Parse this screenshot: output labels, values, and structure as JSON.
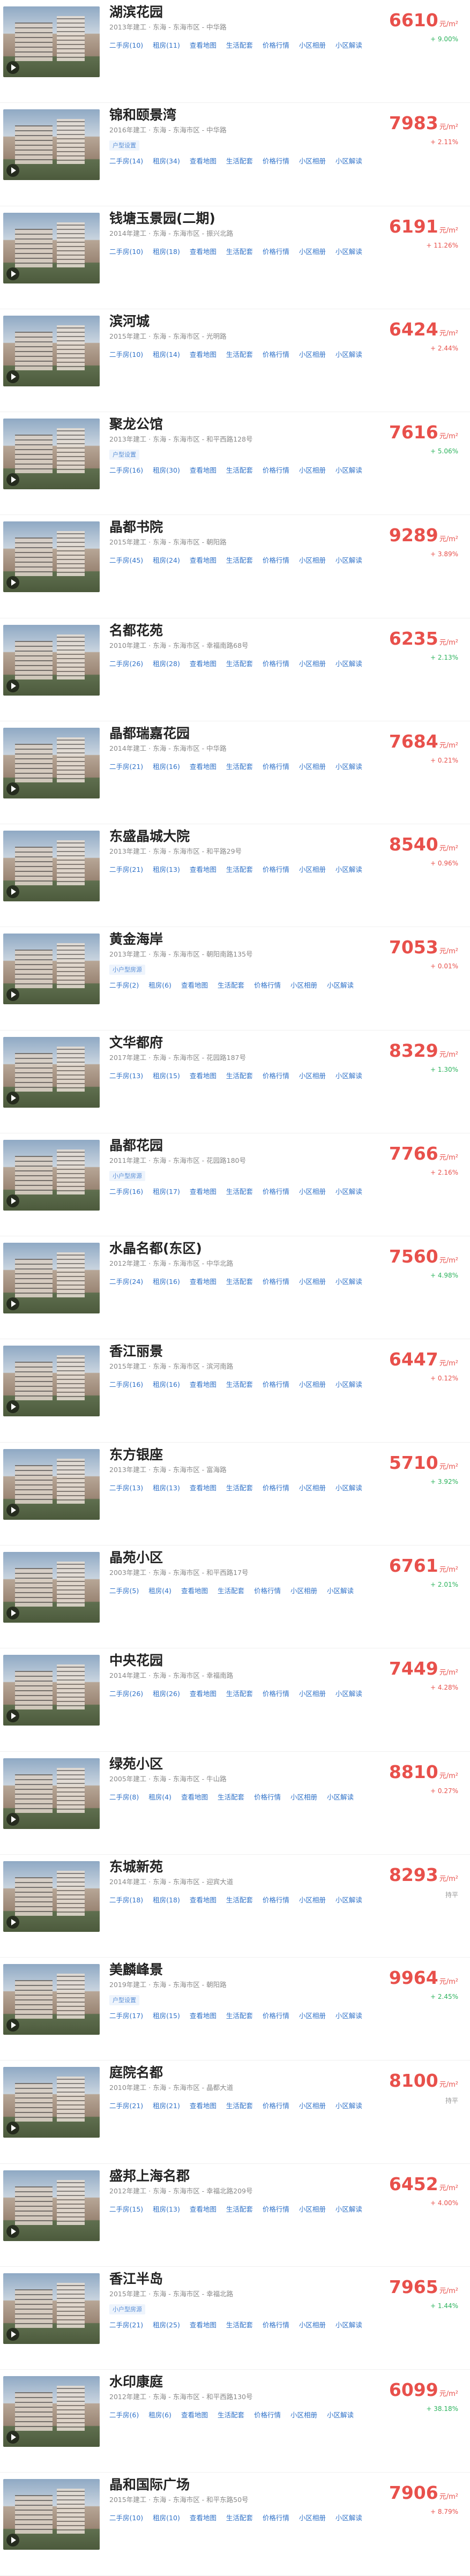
{
  "link_labels": [
    "二手房",
    "租房",
    "查看地图",
    "生活配套",
    "价格行情",
    "小区相册",
    "小区解读"
  ],
  "price_unit": "元/m²",
  "items": [
    {
      "name": "湖滨花园",
      "info": "2013年建工 · 东海 - 东海市区 - 中华路",
      "tag": "",
      "sale": "(10)",
      "rent": "(11)",
      "price": "6610",
      "change": "+ 9.00%",
      "dir": "up"
    },
    {
      "name": "锦和颐景湾",
      "info": "2016年建工 · 东海 - 东海市区 - 中华路",
      "tag": "户型设置",
      "sale": "(14)",
      "rent": "(34)",
      "price": "7983",
      "change": "+ 2.11%",
      "dir": "down"
    },
    {
      "name": "钱塘玉景园(二期)",
      "info": "2014年建工 · 东海 - 东海市区 - 振兴北路",
      "tag": "",
      "sale": "(10)",
      "rent": "(18)",
      "price": "6191",
      "change": "+ 11.26%",
      "dir": "down"
    },
    {
      "name": "滨河城",
      "info": "2015年建工 · 东海 - 东海市区 - 光明路",
      "tag": "",
      "sale": "(10)",
      "rent": "(14)",
      "price": "6424",
      "change": "+ 2.44%",
      "dir": "down"
    },
    {
      "name": "聚龙公馆",
      "info": "2013年建工 · 东海 - 东海市区 - 和平西路128号",
      "tag": "户型设置",
      "sale": "(16)",
      "rent": "(30)",
      "price": "7616",
      "change": "+ 5.06%",
      "dir": "up"
    },
    {
      "name": "晶都书院",
      "info": "2015年建工 · 东海 - 东海市区 - 朝阳路",
      "tag": "",
      "sale": "(45)",
      "rent": "(24)",
      "price": "9289",
      "change": "+ 3.89%",
      "dir": "down"
    },
    {
      "name": "名都花苑",
      "info": "2010年建工 · 东海 - 东海市区 - 幸福南路68号",
      "tag": "",
      "sale": "(26)",
      "rent": "(28)",
      "price": "6235",
      "change": "+ 2.13%",
      "dir": "up"
    },
    {
      "name": "晶都瑞嘉花园",
      "info": "2014年建工 · 东海 - 东海市区 - 中华路",
      "tag": "",
      "sale": "(21)",
      "rent": "(16)",
      "price": "7684",
      "change": "+ 0.21%",
      "dir": "down"
    },
    {
      "name": "东盛晶城大院",
      "info": "2013年建工 · 东海 - 东海市区 - 和平路29号",
      "tag": "",
      "sale": "(21)",
      "rent": "(13)",
      "price": "8540",
      "change": "+ 0.96%",
      "dir": "down"
    },
    {
      "name": "黄金海岸",
      "info": "2013年建工 · 东海 - 东海市区 - 朝阳南路135号",
      "tag": "小户型房源",
      "sale": "(2)",
      "rent": "(6)",
      "price": "7053",
      "change": "+ 0.01%",
      "dir": "down"
    },
    {
      "name": "文华都府",
      "info": "2017年建工 · 东海 - 东海市区 - 花园路187号",
      "tag": "",
      "sale": "(13)",
      "rent": "(15)",
      "price": "8329",
      "change": "+ 1.30%",
      "dir": "up"
    },
    {
      "name": "晶都花园",
      "info": "2011年建工 · 东海 - 东海市区 - 花园路180号",
      "tag": "小户型房源",
      "sale": "(16)",
      "rent": "(17)",
      "price": "7766",
      "change": "+ 2.16%",
      "dir": "down"
    },
    {
      "name": "水晶名都(东区)",
      "info": "2012年建工 · 东海 - 东海市区 - 中华北路",
      "tag": "",
      "sale": "(24)",
      "rent": "(16)",
      "price": "7560",
      "change": "+ 4.98%",
      "dir": "up"
    },
    {
      "name": "香江丽景",
      "info": "2015年建工 · 东海 - 东海市区 - 滨河南路",
      "tag": "",
      "sale": "(16)",
      "rent": "(16)",
      "price": "6447",
      "change": "+ 0.12%",
      "dir": "down"
    },
    {
      "name": "东方银座",
      "info": "2013年建工 · 东海 - 东海市区 - 富海路",
      "tag": "",
      "sale": "(13)",
      "rent": "(13)",
      "price": "5710",
      "change": "+ 3.92%",
      "dir": "up"
    },
    {
      "name": "晶苑小区",
      "info": "2003年建工 · 东海 - 东海市区 - 和平西路17号",
      "tag": "",
      "sale": "(5)",
      "rent": "(4)",
      "price": "6761",
      "change": "+ 2.01%",
      "dir": "up"
    },
    {
      "name": "中央花园",
      "info": "2014年建工 · 东海 - 东海市区 - 幸福南路",
      "tag": "",
      "sale": "(26)",
      "rent": "(26)",
      "price": "7449",
      "change": "+ 4.28%",
      "dir": "down"
    },
    {
      "name": "绿苑小区",
      "info": "2005年建工 · 东海 - 东海市区 - 牛山路",
      "tag": "",
      "sale": "(8)",
      "rent": "(4)",
      "price": "8810",
      "change": "+ 0.27%",
      "dir": "down"
    },
    {
      "name": "东城新苑",
      "info": "2014年建工 · 东海 - 东海市区 - 迎宾大道",
      "tag": "",
      "sale": "(18)",
      "rent": "(18)",
      "price": "8293",
      "change": "持平",
      "dir": "flat"
    },
    {
      "name": "美麟峰景",
      "info": "2019年建工 · 东海 - 东海市区 - 朝阳路",
      "tag": "户型设置",
      "sale": "(17)",
      "rent": "(15)",
      "price": "9964",
      "change": "+ 2.45%",
      "dir": "up"
    },
    {
      "name": "庭院名都",
      "info": "2010年建工 · 东海 - 东海市区 - 晶都大道",
      "tag": "",
      "sale": "(21)",
      "rent": "(21)",
      "price": "8100",
      "change": "持平",
      "dir": "flat"
    },
    {
      "name": "盛邦上海名郡",
      "info": "2012年建工 · 东海 - 东海市区 - 幸福北路209号",
      "tag": "",
      "sale": "(15)",
      "rent": "(13)",
      "price": "6452",
      "change": "+ 4.00%",
      "dir": "down"
    },
    {
      "name": "香江半岛",
      "info": "2015年建工 · 东海 - 东海市区 - 幸福北路",
      "tag": "小户型房源",
      "sale": "(21)",
      "rent": "(25)",
      "price": "7965",
      "change": "+ 1.44%",
      "dir": "up"
    },
    {
      "name": "水印康庭",
      "info": "2012年建工 · 东海 - 东海市区 - 和平西路130号",
      "tag": "",
      "sale": "(6)",
      "rent": "(6)",
      "price": "6099",
      "change": "+ 38.18%",
      "dir": "up"
    },
    {
      "name": "晶和国际广场",
      "info": "2015年建工 · 东海 - 东海市区 - 和平东路50号",
      "tag": "",
      "sale": "(10)",
      "rent": "(10)",
      "price": "7906",
      "change": "+ 8.79%",
      "dir": "down"
    }
  ]
}
